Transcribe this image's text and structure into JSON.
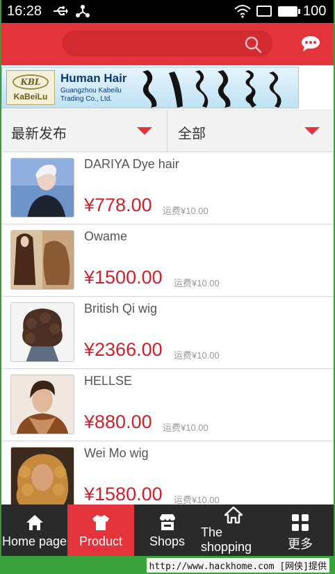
{
  "status_bar": {
    "time": "16:28",
    "battery_level": "100"
  },
  "header": {
    "search_placeholder": ""
  },
  "banner": {
    "logo_badge": "KBL",
    "logo_name": "KaBeiLu",
    "title": "Human Hair",
    "subtitle": "Guangzhou Kabeilu Trading Co., Ltd."
  },
  "filters": [
    {
      "label": "最新发布"
    },
    {
      "label": "全部"
    }
  ],
  "products": [
    {
      "name": "DARIYA Dye hair",
      "price": "¥778.00",
      "shipping": "运费¥10.00"
    },
    {
      "name": "Owame",
      "price": "¥1500.00",
      "shipping": "运费¥10.00"
    },
    {
      "name": "British Qi wig",
      "price": "¥2366.00",
      "shipping": "运费¥10.00"
    },
    {
      "name": "HELLSE",
      "price": "¥880.00",
      "shipping": "运费¥10.00"
    },
    {
      "name": "Wei Mo wig",
      "price": "¥1580.00",
      "shipping": "运费¥10.00"
    }
  ],
  "tabs": [
    {
      "label": "Home page",
      "icon": "home-icon",
      "active": false
    },
    {
      "label": "Product",
      "icon": "shirt-icon",
      "active": true
    },
    {
      "label": "Shops",
      "icon": "store-icon",
      "active": false
    },
    {
      "label": "The shopping",
      "icon": "home-icon",
      "active": false
    },
    {
      "label": "更多",
      "icon": "grid-icon",
      "active": false
    }
  ],
  "watermark": "http://www.hackhome.com [网侠]提供",
  "colors": {
    "accent": "#e3333b",
    "price": "#d01f2b",
    "tabbar": "#2a2a2a"
  }
}
